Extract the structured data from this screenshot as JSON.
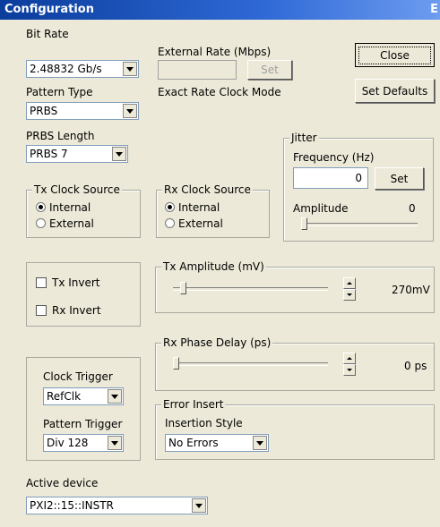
{
  "window": {
    "title": "Configuration",
    "edge_char": "E"
  },
  "bit_rate": {
    "label": "Bit Rate",
    "value": "2.48832 Gb/s"
  },
  "pattern_type": {
    "label": "Pattern Type",
    "value": "PRBS"
  },
  "prbs_length": {
    "label": "PRBS Length",
    "value": "PRBS 7"
  },
  "external_rate": {
    "label": "External Rate (Mbps)",
    "value": "",
    "set_label": "Set",
    "mode_text": "Exact Rate Clock Mode"
  },
  "buttons": {
    "close": "Close",
    "set_defaults": "Set Defaults"
  },
  "jitter": {
    "title": "Jitter",
    "frequency_label": "Frequency (Hz)",
    "frequency_value": "0",
    "set_label": "Set",
    "amplitude_label": "Amplitude",
    "amplitude_value": "0",
    "amplitude_level": 0.0
  },
  "tx_clock": {
    "title": "Tx Clock Source",
    "internal": "Internal",
    "external": "External",
    "selected": "Internal"
  },
  "rx_clock": {
    "title": "Rx Clock Source",
    "internal": "Internal",
    "external": "External",
    "selected": "Internal"
  },
  "invert": {
    "tx": "Tx Invert",
    "rx": "Rx Invert",
    "tx_checked": false,
    "rx_checked": false
  },
  "tx_amplitude": {
    "title": "Tx Amplitude (mV)",
    "value": "270mV",
    "level": 0.05
  },
  "rx_phase": {
    "title": "Rx Phase Delay (ps)",
    "value": "0 ps",
    "level": 0.0
  },
  "triggers": {
    "clock_label": "Clock Trigger",
    "clock_value": "RefClk",
    "pattern_label": "Pattern Trigger",
    "pattern_value": "Div 128"
  },
  "error_insert": {
    "title": "Error Insert",
    "style_label": "Insertion Style",
    "style_value": "No Errors"
  },
  "active_device": {
    "label": "Active device",
    "value": "PXI2::15::INSTR"
  }
}
